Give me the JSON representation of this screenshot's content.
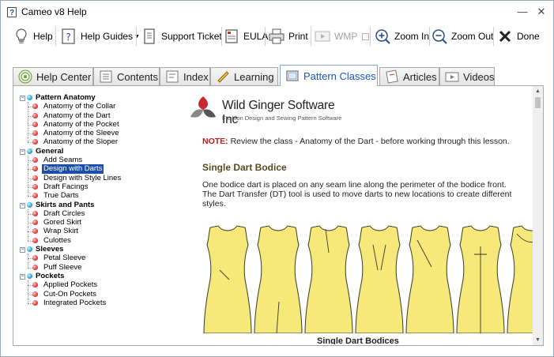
{
  "window": {
    "title": "Cameo v8 Help"
  },
  "toolbar": {
    "help": "Help",
    "help_guides": "Help Guides",
    "support_ticket": "Support Ticket",
    "eula": "EULA",
    "print": "Print",
    "wmp": "WMP",
    "zoom_in": "Zoom In",
    "zoom_out": "Zoom Out",
    "done": "Done"
  },
  "tabs": [
    {
      "label": "Help Center",
      "icon": "target-icon"
    },
    {
      "label": "Contents",
      "icon": "contents-icon"
    },
    {
      "label": "Index",
      "icon": "index-icon"
    },
    {
      "label": "Learning",
      "icon": "learning-icon"
    },
    {
      "label": "Pattern Classes",
      "icon": "pattern-classes-icon",
      "active": true
    },
    {
      "label": "Articles",
      "icon": "articles-icon"
    },
    {
      "label": "Videos",
      "icon": "videos-icon"
    }
  ],
  "tree": {
    "groups": [
      {
        "label": "Pattern Anatomy",
        "items": [
          "Anatomy of the Collar",
          "Anatomy of the Dart",
          "Anatomy of the Pocket",
          "Anatomy of the Sleeve",
          "Anatomy of the Sloper"
        ]
      },
      {
        "label": "General",
        "items": [
          "Add Seams",
          "Design with Darts",
          "Design with Style Lines",
          "Draft Facings",
          "True Darts"
        ]
      },
      {
        "label": "Skirts and Pants",
        "items": [
          "Draft Circles",
          "Gored Skirt",
          "Wrap Skirt",
          "Culottes"
        ]
      },
      {
        "label": "Sleeves",
        "items": [
          "Petal Sleeve",
          "Puff Sleeve"
        ]
      },
      {
        "label": "Pockets",
        "items": [
          "Applied Pockets",
          "Cut-On Pockets",
          "Integrated Pockets"
        ]
      }
    ],
    "selected": "Design with Darts"
  },
  "article": {
    "logo_name": "Wild Ginger Software Inc",
    "logo_tagline": "Fashion Design and Sewing Pattern Software",
    "note_label": "NOTE:",
    "note_text": " Review the class - Anatomy of the Dart - before working through this lesson.",
    "heading": "Single Dart Bodice",
    "paragraph": "One bodice dart is placed on any seam line along the perimeter of the bodice front. The Dart Transfer (DT) tool is used to move darts to new locations to create different styles.",
    "caption": "Single Dart Bodices"
  },
  "colors": {
    "bodice_fill": "#f6e97a",
    "bodice_stroke": "#3a3a2a",
    "accent": "#1a57c2",
    "note_red": "#c01a1a"
  }
}
